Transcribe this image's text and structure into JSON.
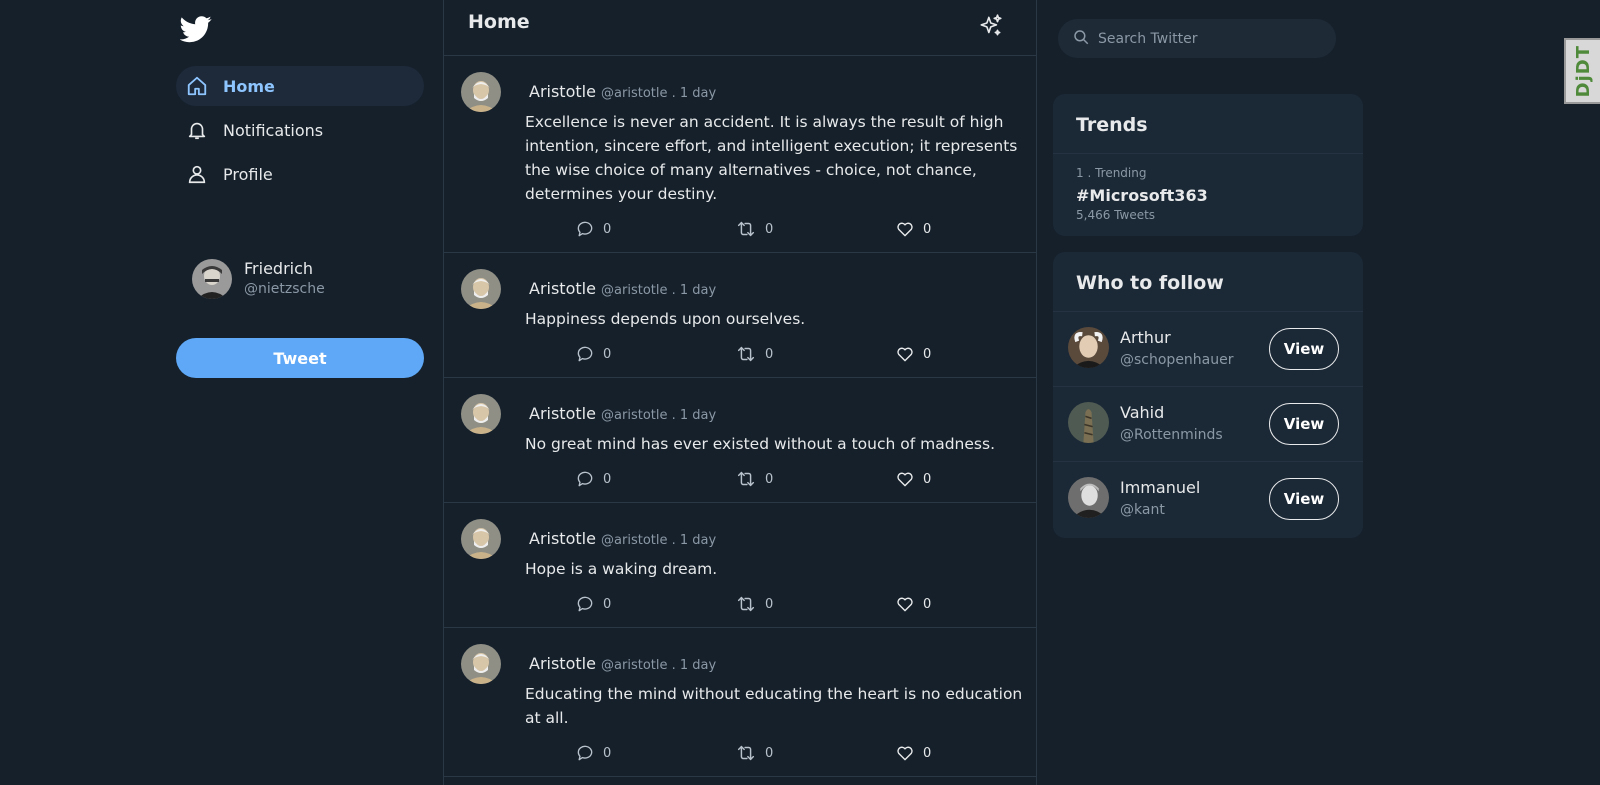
{
  "app": {
    "brand_icon": "twitter-bird-icon",
    "accent_color": "#5ea8f7",
    "background_color": "#15202b"
  },
  "sidebar": {
    "items": [
      {
        "label": "Home",
        "icon": "home-icon",
        "active": true
      },
      {
        "label": "Notifications",
        "icon": "bell-icon",
        "active": false
      },
      {
        "label": "Profile",
        "icon": "user-icon",
        "active": false
      }
    ],
    "current_user": {
      "name": "Friedrich",
      "handle": "@nietzsche"
    },
    "tweet_button": "Tweet"
  },
  "feed": {
    "title": "Home",
    "tweets": [
      {
        "author": "Aristotle",
        "meta": "@aristotle . 1 day",
        "text": "Excellence is never an accident. It is always the result of high intention, sincere effort, and intelligent execution; it represents the wise choice of many alternatives - choice, not chance, determines your destiny.",
        "replies": "0",
        "retweets": "0",
        "likes": "0"
      },
      {
        "author": "Aristotle",
        "meta": "@aristotle . 1 day",
        "text": "Happiness depends upon ourselves.",
        "replies": "0",
        "retweets": "0",
        "likes": "0"
      },
      {
        "author": "Aristotle",
        "meta": "@aristotle . 1 day",
        "text": "No great mind has ever existed without a touch of madness.",
        "replies": "0",
        "retweets": "0",
        "likes": "0"
      },
      {
        "author": "Aristotle",
        "meta": "@aristotle . 1 day",
        "text": "Hope is a waking dream.",
        "replies": "0",
        "retweets": "0",
        "likes": "0"
      },
      {
        "author": "Aristotle",
        "meta": "@aristotle . 1 day",
        "text": "Educating the mind without educating the heart is no education at all.",
        "replies": "0",
        "retweets": "0",
        "likes": "0"
      }
    ]
  },
  "search": {
    "placeholder": "Search Twitter"
  },
  "trends": {
    "title": "Trends",
    "items": [
      {
        "rank": "1 . Trending",
        "tag": "#Microsoft363",
        "count": "5,466 Tweets"
      }
    ]
  },
  "who_to_follow": {
    "title": "Who to follow",
    "button_label": "View",
    "users": [
      {
        "name": "Arthur",
        "handle": "@schopenhauer"
      },
      {
        "name": "Vahid",
        "handle": "@Rottenminds"
      },
      {
        "name": "Immanuel",
        "handle": "@kant"
      }
    ]
  },
  "debug_toolbar": {
    "label": "DjDT"
  }
}
